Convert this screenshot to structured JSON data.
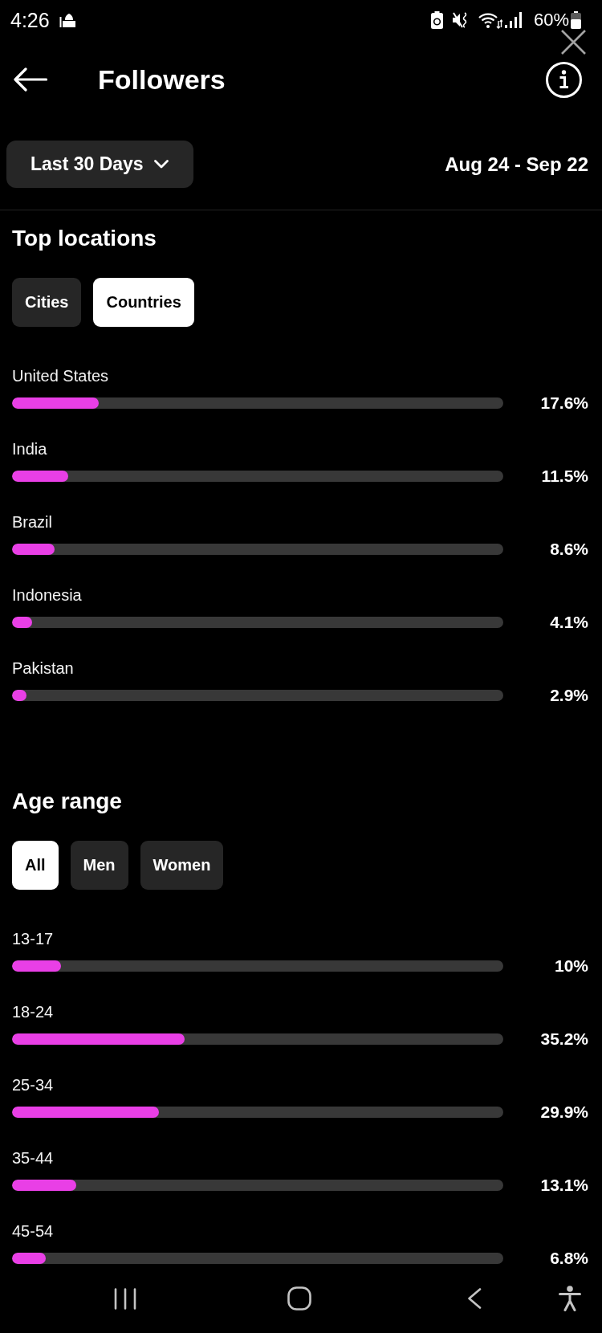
{
  "status_bar": {
    "time": "4:26",
    "battery": "60%"
  },
  "header": {
    "title": "Followers"
  },
  "filter": {
    "range": "Last 30 Days",
    "dates": "Aug 24 - Sep 22"
  },
  "sections": [
    {
      "title": "Top locations",
      "tabs": [
        {
          "label": "Cities",
          "selected": false
        },
        {
          "label": "Countries",
          "selected": true
        }
      ],
      "rows": [
        {
          "label": "United States",
          "level": 0.176,
          "reading": "17.6%"
        },
        {
          "label": "India",
          "level": 0.115,
          "reading": "11.5%"
        },
        {
          "label": "Brazil",
          "level": 0.086,
          "reading": "8.6%"
        },
        {
          "label": "Indonesia",
          "level": 0.041,
          "reading": "4.1%"
        },
        {
          "label": "Pakistan",
          "level": 0.029,
          "reading": "2.9%"
        }
      ]
    },
    {
      "title": "Age range",
      "tabs": [
        {
          "label": "All",
          "selected": true
        },
        {
          "label": "Men",
          "selected": false
        },
        {
          "label": "Women",
          "selected": false
        }
      ],
      "rows": [
        {
          "label": "13-17",
          "level": 0.1,
          "reading": "10%"
        },
        {
          "label": "18-24",
          "level": 0.352,
          "reading": "35.2%"
        },
        {
          "label": "25-34",
          "level": 0.299,
          "reading": "29.9%"
        },
        {
          "label": "35-44",
          "level": 0.131,
          "reading": "13.1%"
        },
        {
          "label": "45-54",
          "level": 0.068,
          "reading": "6.8%"
        }
      ]
    }
  ]
}
